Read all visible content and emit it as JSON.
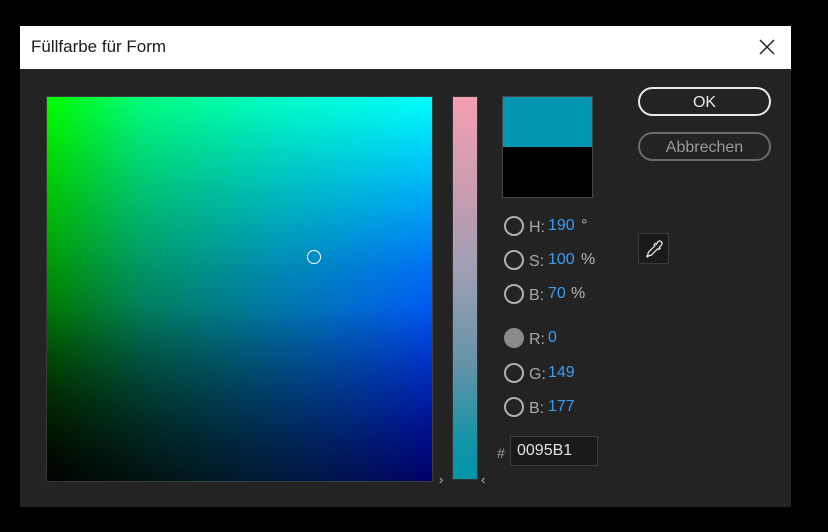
{
  "window": {
    "title": "Füllfarbe für Form"
  },
  "buttons": {
    "ok": "OK",
    "cancel": "Abbrechen"
  },
  "swatch": {
    "new_color": "#0095B1",
    "old_color": "#000000"
  },
  "fields": {
    "h": {
      "label": "H:",
      "value": "190",
      "unit": "°"
    },
    "s": {
      "label": "S:",
      "value": "100",
      "unit": "%"
    },
    "b_hsb": {
      "label": "B:",
      "value": "70",
      "unit": "%"
    },
    "r": {
      "label": "R:",
      "value": "0"
    },
    "g": {
      "label": "G:",
      "value": "149"
    },
    "b_rgb": {
      "label": "B:",
      "value": "177"
    }
  },
  "hex": {
    "prefix": "#",
    "value": "0095B1"
  },
  "slider_markers": {
    "left": "›",
    "right": "‹"
  },
  "icons": {
    "close": "close-icon",
    "eyedropper": "eyedropper-icon"
  },
  "colors": {
    "accent_value": "#3B9CF0",
    "dialog_bg": "#232323"
  }
}
